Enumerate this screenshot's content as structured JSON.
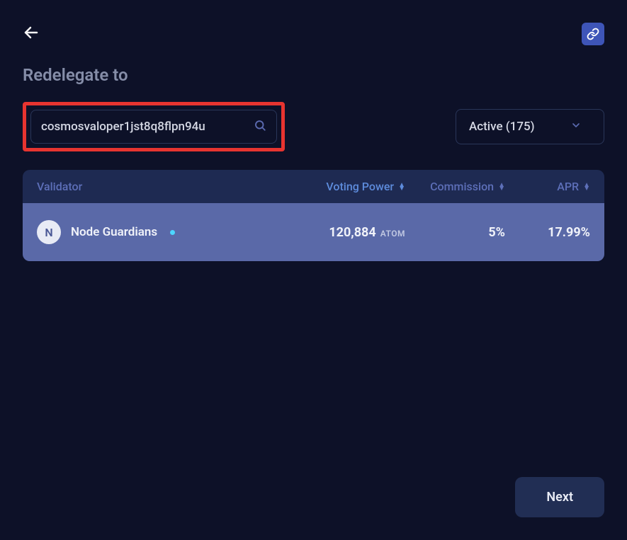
{
  "header": {
    "title": "Redelegate to"
  },
  "search": {
    "value": "cosmosvaloper1jst8q8flpn94u"
  },
  "filter": {
    "label": "Active (175)"
  },
  "table": {
    "columns": {
      "validator": "Validator",
      "voting_power": "Voting Power",
      "commission": "Commission",
      "apr": "APR"
    },
    "rows": [
      {
        "avatar_letter": "N",
        "name": "Node Guardians",
        "voting_amount": "120,884",
        "voting_unit": "ATOM",
        "commission": "5%",
        "apr": "17.99%"
      }
    ]
  },
  "footer": {
    "next_label": "Next"
  }
}
